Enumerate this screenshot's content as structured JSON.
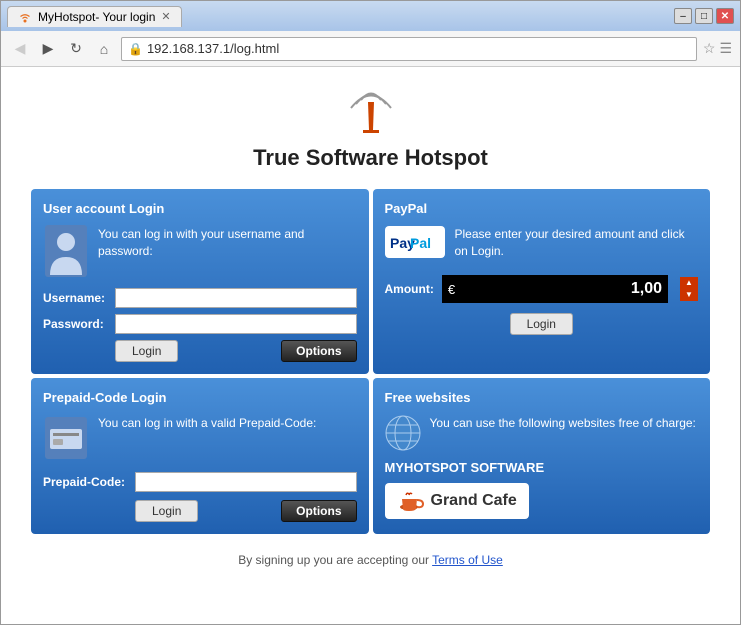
{
  "window": {
    "title": "MyHotspot- Your login",
    "tab_label": "MyHotspot- Your login",
    "url": "192.168.137.1/log.html",
    "minimize": "–",
    "maximize": "□",
    "close": "✕"
  },
  "nav": {
    "back": "◀",
    "forward": "▶",
    "reload": "↺",
    "home": "⌂"
  },
  "page": {
    "title": "True Software Hotspot"
  },
  "user_panel": {
    "title": "User account Login",
    "description": "You can log in with  your username and password:",
    "username_label": "Username:",
    "password_label": "Password:",
    "login_btn": "Login",
    "options_btn": "Options"
  },
  "paypal_panel": {
    "title": "PayPal",
    "description": "Please enter your desired amount and click on Login.",
    "amount_label": "Amount:",
    "euro": "€",
    "amount_value": "1,00",
    "login_btn": "Login"
  },
  "prepaid_panel": {
    "title": "Prepaid-Code Login",
    "description": "You can log in with a valid Prepaid-Code:",
    "code_label": "Prepaid-Code:",
    "login_btn": "Login",
    "options_btn": "Options"
  },
  "free_panel": {
    "title": "Free websites",
    "description": "You can use the  following websites  free of charge:",
    "brand": "MYHOTSPOT SOFTWARE",
    "cafe_name": "Grand Cafe"
  },
  "footer": {
    "text": "By signing up you are accepting our ",
    "terms": "Terms of Use"
  }
}
